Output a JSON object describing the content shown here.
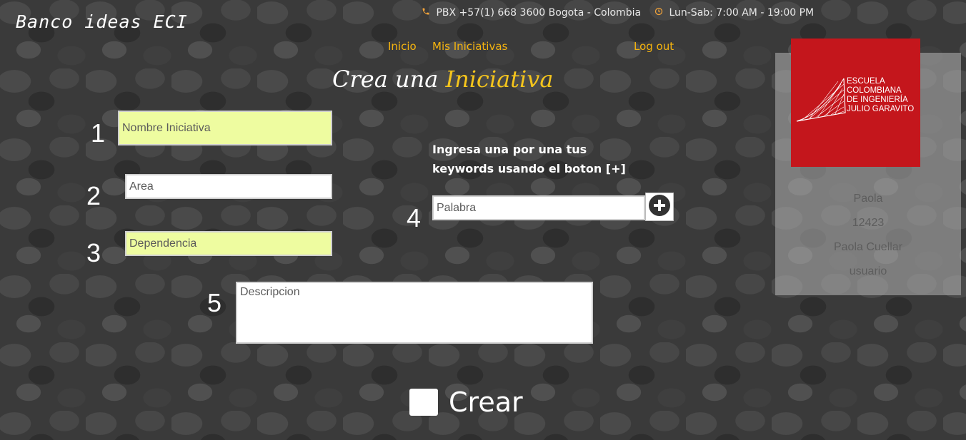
{
  "header": {
    "brand": "Banco ideas ECI",
    "phone": "PBX +57(1) 668 3600 Bogota - Colombia",
    "hours": "Lun-Sab: 7:00 AM - 19:00 PM",
    "phone_icon": "phone-icon",
    "hours_icon": "clock-icon"
  },
  "nav": {
    "inicio": "Inicio",
    "mis_iniciativas": "Mis Iniciativas",
    "logout": "Log out"
  },
  "title": {
    "part1": "Crea una",
    "part2": "Iniciativa"
  },
  "form": {
    "nombre": {
      "number": "1",
      "placeholder": "Nombre Iniciativa",
      "value": ""
    },
    "area": {
      "number": "2",
      "placeholder": "Area",
      "value": ""
    },
    "dependencia": {
      "number": "3",
      "placeholder": "Dependencia",
      "value": ""
    },
    "keywords": {
      "number": "4",
      "instructions": "Ingresa una por una tus keywords usando el boton [+]",
      "placeholder": "Palabra",
      "add_icon": "plus-circle-icon"
    },
    "descripcion": {
      "number": "5",
      "placeholder": "Descripcion",
      "value": ""
    },
    "submit_label": "Crear"
  },
  "profile": {
    "logo_lines": [
      "Escuela",
      "Colombiana",
      "de Ingeniería",
      "Julio Garavito"
    ],
    "name": "Paola",
    "id": "12423",
    "full_name": "Paola Cuellar",
    "role": "usuario"
  },
  "colors": {
    "accent": "#f5b40f",
    "logo_bg": "#c4161c",
    "field_highlight": "#eefca0"
  }
}
